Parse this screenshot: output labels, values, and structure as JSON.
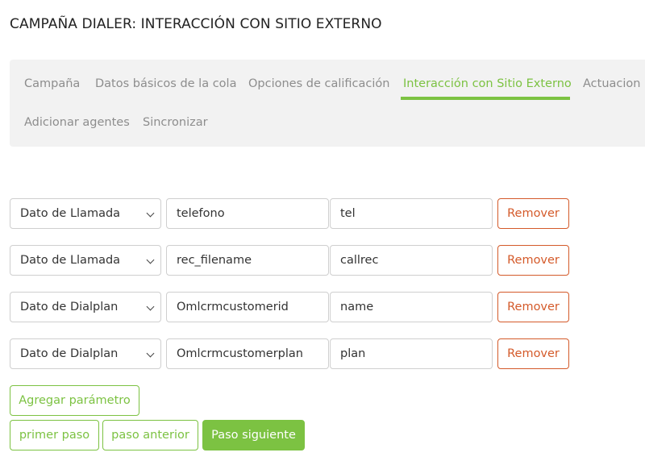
{
  "page": {
    "title": "CAMPAÑA DIALER: INTERACCIÓN CON SITIO EXTERNO"
  },
  "tabs": [
    {
      "label": "Campaña",
      "active": false
    },
    {
      "label": "Datos básicos de la cola",
      "active": false
    },
    {
      "label": "Opciones de calificación",
      "active": false
    },
    {
      "label": "Interacción con Sitio Externo",
      "active": true
    },
    {
      "label": "Actuacion",
      "active": false
    },
    {
      "label": "Adicionar agentes",
      "active": false
    },
    {
      "label": "Sincronizar",
      "active": false
    }
  ],
  "parameters": [
    {
      "type": "Dato de Llamada",
      "field": "telefono",
      "name": "tel",
      "remove_label": "Remover"
    },
    {
      "type": "Dato de Llamada",
      "field": "rec_filename",
      "name": "callrec",
      "remove_label": "Remover"
    },
    {
      "type": "Dato de Dialplan",
      "field": "Omlcrmcustomerid",
      "name": "name",
      "remove_label": "Remover"
    },
    {
      "type": "Dato de Dialplan",
      "field": "Omlcrmcustomerplan",
      "name": "plan",
      "remove_label": "Remover"
    }
  ],
  "actions": {
    "add_parameter": "Agregar parámetro",
    "first_step": "primer paso",
    "previous_step": "paso anterior",
    "next_step": "Paso siguiente"
  },
  "colors": {
    "accent": "#7cc242",
    "remove": "#d45a2a",
    "tab_inactive": "#8d8d8d",
    "panel_bg": "#f2f2f2"
  }
}
